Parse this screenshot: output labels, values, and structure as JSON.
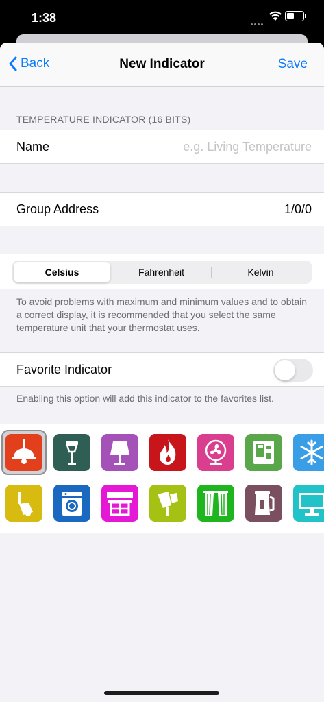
{
  "status_bar": {
    "time": "1:38"
  },
  "nav": {
    "back_label": "Back",
    "title": "New Indicator",
    "save_label": "Save"
  },
  "section": {
    "header": "TEMPERATURE INDICATOR (16 BITS)"
  },
  "name_field": {
    "label": "Name",
    "placeholder": "e.g. Living Temperature"
  },
  "group_address": {
    "label": "Group Address",
    "value": "1/0/0"
  },
  "units": {
    "options": [
      "Celsius",
      "Fahrenheit",
      "Kelvin"
    ],
    "selected": "Celsius"
  },
  "unit_footer": "To avoid problems with maximum and minimum values and to obtain a correct display, it is recommended that you select the same temperature unit that your thermostat uses.",
  "favorite": {
    "label": "Favorite Indicator",
    "on": false,
    "footer": "Enabling this option will add this indicator to the favorites list."
  },
  "icons": {
    "selected": "ceiling-lamp-icon",
    "row1": [
      {
        "name": "ceiling-lamp-icon",
        "color": "#e2401c"
      },
      {
        "name": "street-lamp-icon",
        "color": "#2f5f54"
      },
      {
        "name": "table-lamp-icon",
        "color": "#a451b8"
      },
      {
        "name": "fire-icon",
        "color": "#c8151b"
      },
      {
        "name": "fan-icon",
        "color": "#d93f8e"
      },
      {
        "name": "coffee-machine-icon",
        "color": "#5aa64a"
      },
      {
        "name": "snowflake-icon",
        "color": "#3a9ee6"
      }
    ],
    "row2": [
      {
        "name": "spotlight-icon",
        "color": "#d8bb10"
      },
      {
        "name": "washing-machine-icon",
        "color": "#1b68c0"
      },
      {
        "name": "awning-window-icon",
        "color": "#e518d6"
      },
      {
        "name": "wall-spotlight-icon",
        "color": "#a5c214"
      },
      {
        "name": "curtains-icon",
        "color": "#1fb51f"
      },
      {
        "name": "kettle-icon",
        "color": "#7a5060"
      },
      {
        "name": "monitor-icon",
        "color": "#21c2c8"
      }
    ]
  }
}
